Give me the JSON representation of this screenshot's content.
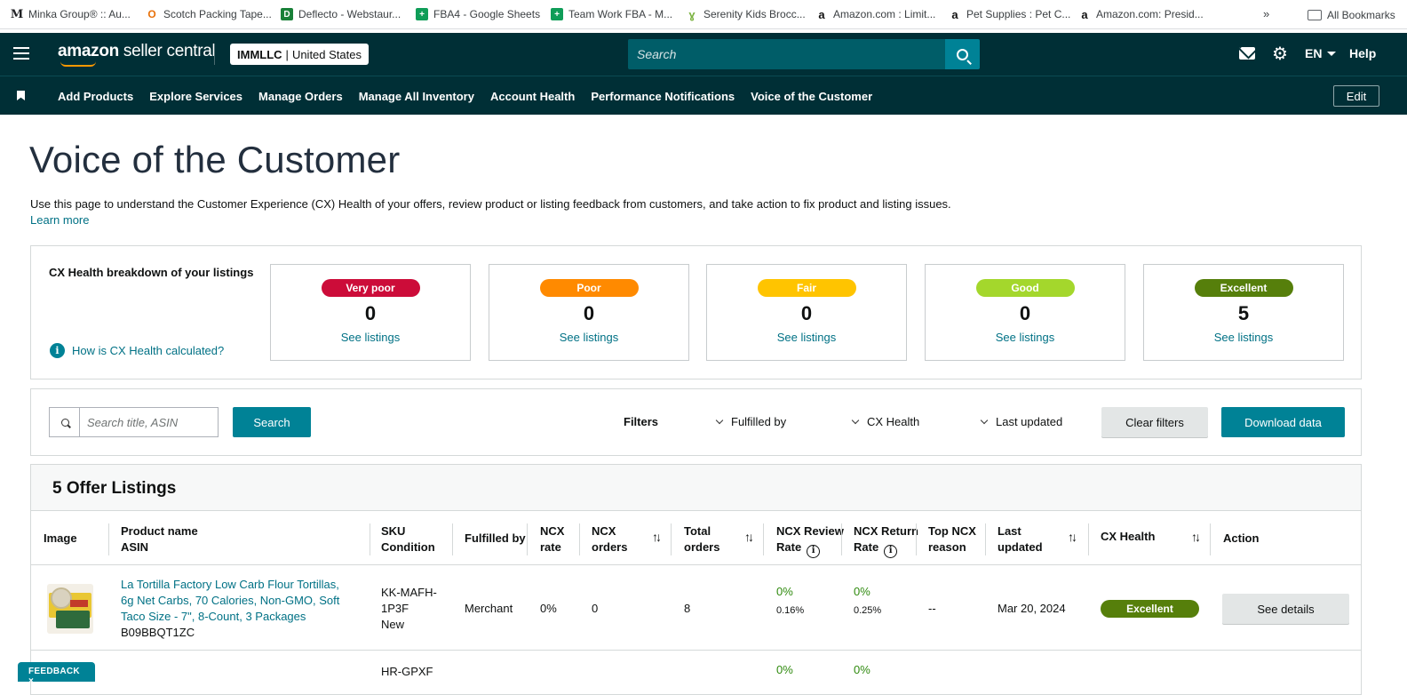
{
  "bookmarks": [
    {
      "label": "Minka Group® :: Au...",
      "icon": "M",
      "color": "#202124"
    },
    {
      "label": "Scotch Packing Tape...",
      "icon": "O",
      "color": "#e8710a"
    },
    {
      "label": "Deflecto - Webstaur...",
      "icon": "D",
      "color": "#188038"
    },
    {
      "label": "FBA4 - Google Sheets",
      "icon": "+",
      "color": "#0f9d58"
    },
    {
      "label": "Team Work FBA - M...",
      "icon": "+",
      "color": "#0f9d58"
    },
    {
      "label": "Serenity Kids Brocc...",
      "icon": "s",
      "color": "#7cb342"
    },
    {
      "label": "Amazon.com : Limit...",
      "icon": "a",
      "color": "#232f3e"
    },
    {
      "label": "Pet Supplies : Pet C...",
      "icon": "a",
      "color": "#232f3e"
    },
    {
      "label": "Amazon.com: Presid...",
      "icon": "a",
      "color": "#232f3e"
    }
  ],
  "bookmarks_more": "»",
  "all_bookmarks": "All Bookmarks",
  "topnav": {
    "logo_bold": "amazon",
    "logo_rest": " seller central",
    "account_name": "IMMLLC",
    "account_region": "United States",
    "search_placeholder": "Search",
    "language": "EN",
    "help": "Help"
  },
  "subnav": {
    "items": [
      "Add Products",
      "Explore Services",
      "Manage Orders",
      "Manage All Inventory",
      "Account Health",
      "Performance Notifications",
      "Voice of the Customer"
    ],
    "edit": "Edit"
  },
  "page": {
    "title": "Voice of the Customer",
    "description": "Use this page to understand the Customer Experience (CX) Health of your offers, review product or listing feedback from customers, and take action to fix product and listing issues.",
    "learn_more": "Learn more"
  },
  "cx_health": {
    "title": "CX Health breakdown of your listings",
    "how_link": "How is CX Health calculated?",
    "cards": [
      {
        "label": "Very poor",
        "count": "0",
        "link": "See listings",
        "color": "#cc0c39"
      },
      {
        "label": "Poor",
        "count": "0",
        "link": "See listings",
        "color": "#ff8a00"
      },
      {
        "label": "Fair",
        "count": "0",
        "link": "See listings",
        "color": "#ffc400"
      },
      {
        "label": "Good",
        "count": "0",
        "link": "See listings",
        "color": "#a4d72c"
      },
      {
        "label": "Excellent",
        "count": "5",
        "link": "See listings",
        "color": "#567f0b"
      }
    ]
  },
  "filters": {
    "search_placeholder": "Search title, ASIN",
    "search_button": "Search",
    "label": "Filters",
    "fulfilled_by": "Fulfilled by",
    "cx_health": "CX Health",
    "last_updated": "Last updated",
    "clear": "Clear filters",
    "download": "Download data"
  },
  "listings": {
    "heading": "5 Offer Listings",
    "columns": {
      "image": "Image",
      "product_name": "Product name",
      "asin": "ASIN",
      "sku": "SKU",
      "condition": "Condition",
      "fulfilled_by": "Fulfilled by",
      "ncx_rate_1": "NCX",
      "ncx_rate_2": "rate",
      "ncx_orders_1": "NCX",
      "ncx_orders_2": "orders",
      "total_orders_1": "Total",
      "total_orders_2": "orders",
      "ncx_review_1": "NCX Review",
      "ncx_review_2": "Rate",
      "ncx_return_1": "NCX Return",
      "ncx_return_2": "Rate",
      "top_ncx_1": "Top NCX",
      "top_ncx_2": "reason",
      "last_updated_1": "Last",
      "last_updated_2": "updated",
      "cx_health": "CX Health",
      "action": "Action"
    },
    "rows": [
      {
        "product_line1": "La Tortilla Factory Low Carb Flour Tortillas,",
        "product_line2": "6g Net Carbs, 70 Calories, Non-GMO, Soft",
        "product_line3": "Taco Size - 7\", 8-Count, 3 Packages",
        "asin": "B09BBQT1ZC",
        "sku_line1": "KK-MAFH-",
        "sku_line2": "1P3F",
        "condition": "New",
        "fulfilled_by": "Merchant",
        "ncx_rate": "0%",
        "ncx_orders": "0",
        "total_orders": "8",
        "ncx_review_rate": "0%",
        "ncx_review_sub": "0.16%",
        "ncx_return_rate": "0%",
        "ncx_return_sub": "0.25%",
        "top_ncx_reason": "--",
        "last_updated": "Mar 20, 2024",
        "cx_health": "Excellent",
        "action": "See details"
      },
      {
        "sku_line1": "HR-GPXF",
        "ncx_review_rate": "0%",
        "ncx_return_rate": "0%"
      }
    ]
  },
  "feedback": "FEEDBACK ×"
}
